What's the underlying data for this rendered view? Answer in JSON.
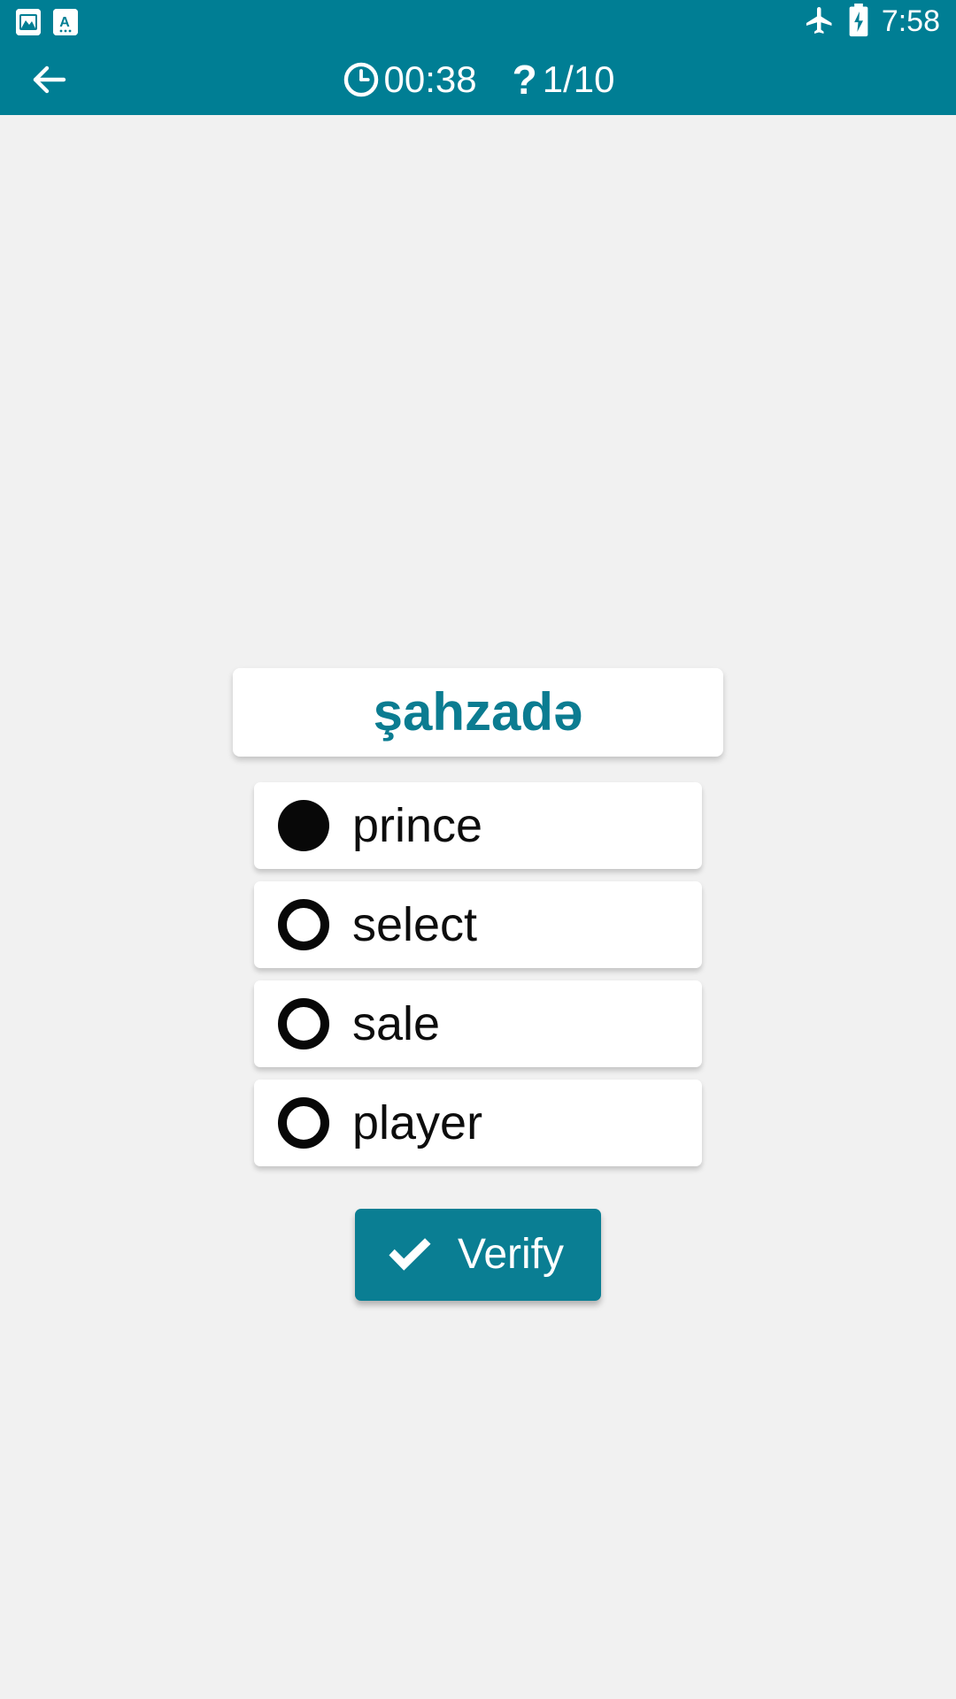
{
  "status_bar": {
    "notifications": [
      {
        "icon": "image-icon",
        "name": "image-notification"
      },
      {
        "icon": "translate-letter-icon",
        "name": "translate-notification"
      }
    ],
    "airplane_icon": "airplane-mode-icon",
    "battery_icon": "battery-charging-icon",
    "time": "7:58"
  },
  "app_bar": {
    "back_icon": "arrow-left-icon",
    "timer_icon": "clock-icon",
    "timer": "00:38",
    "question_icon": "question-mark-icon",
    "question_counter": "1/10"
  },
  "quiz": {
    "word": "şahzadə",
    "options": [
      {
        "label": "prince",
        "selected": true
      },
      {
        "label": "select",
        "selected": false
      },
      {
        "label": "sale",
        "selected": false
      },
      {
        "label": "player",
        "selected": false
      }
    ],
    "verify_label": "Verify",
    "verify_icon": "check-icon"
  },
  "colors": {
    "accent": "#007e94",
    "button": "#0a7e93",
    "word_text": "#0b7c91",
    "background": "#f1f1f1",
    "card": "#ffffff",
    "radio": "#080808"
  }
}
